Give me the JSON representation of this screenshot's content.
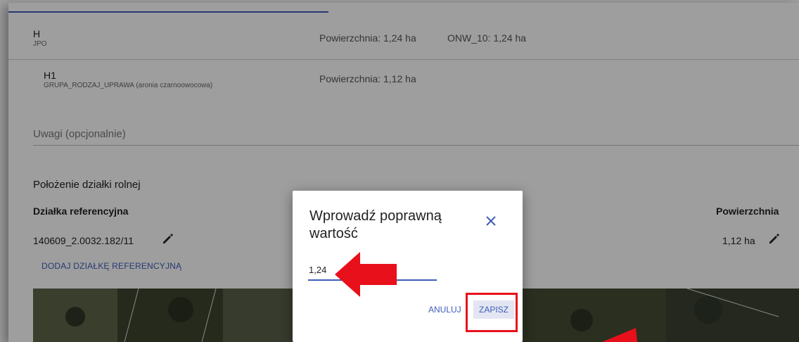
{
  "rows": [
    {
      "code": "H",
      "sub": "JPO",
      "area": "Powierzchnia: 1,24 ha",
      "onw": "ONW_10: 1,24 ha"
    },
    {
      "code": "H1",
      "sub": "GRUPA_RODZAJ_UPRAWA (aronia czarnoowocowa)",
      "area": "Powierzchnia: 1,12 ha"
    }
  ],
  "remarks": {
    "placeholder": "Uwagi (opcjonalnie)"
  },
  "location": {
    "title": "Położenie działki rolnej",
    "col_parcel": "Działka referencyjna",
    "col_area": "Powierzchnia",
    "parcel_id": "140609_2.0032.182/11",
    "parcel_area": "1,12 ha",
    "add_parcel": "DODAJ DZIAŁKĘ REFERENCYJNĄ"
  },
  "dialog": {
    "title": "Wprowadź poprawną wartość",
    "input_value": "1,24",
    "cancel": "ANULUJ",
    "save": "ZAPISZ"
  },
  "colors": {
    "accent": "#3f5db8",
    "annotation": "#e8101a"
  }
}
